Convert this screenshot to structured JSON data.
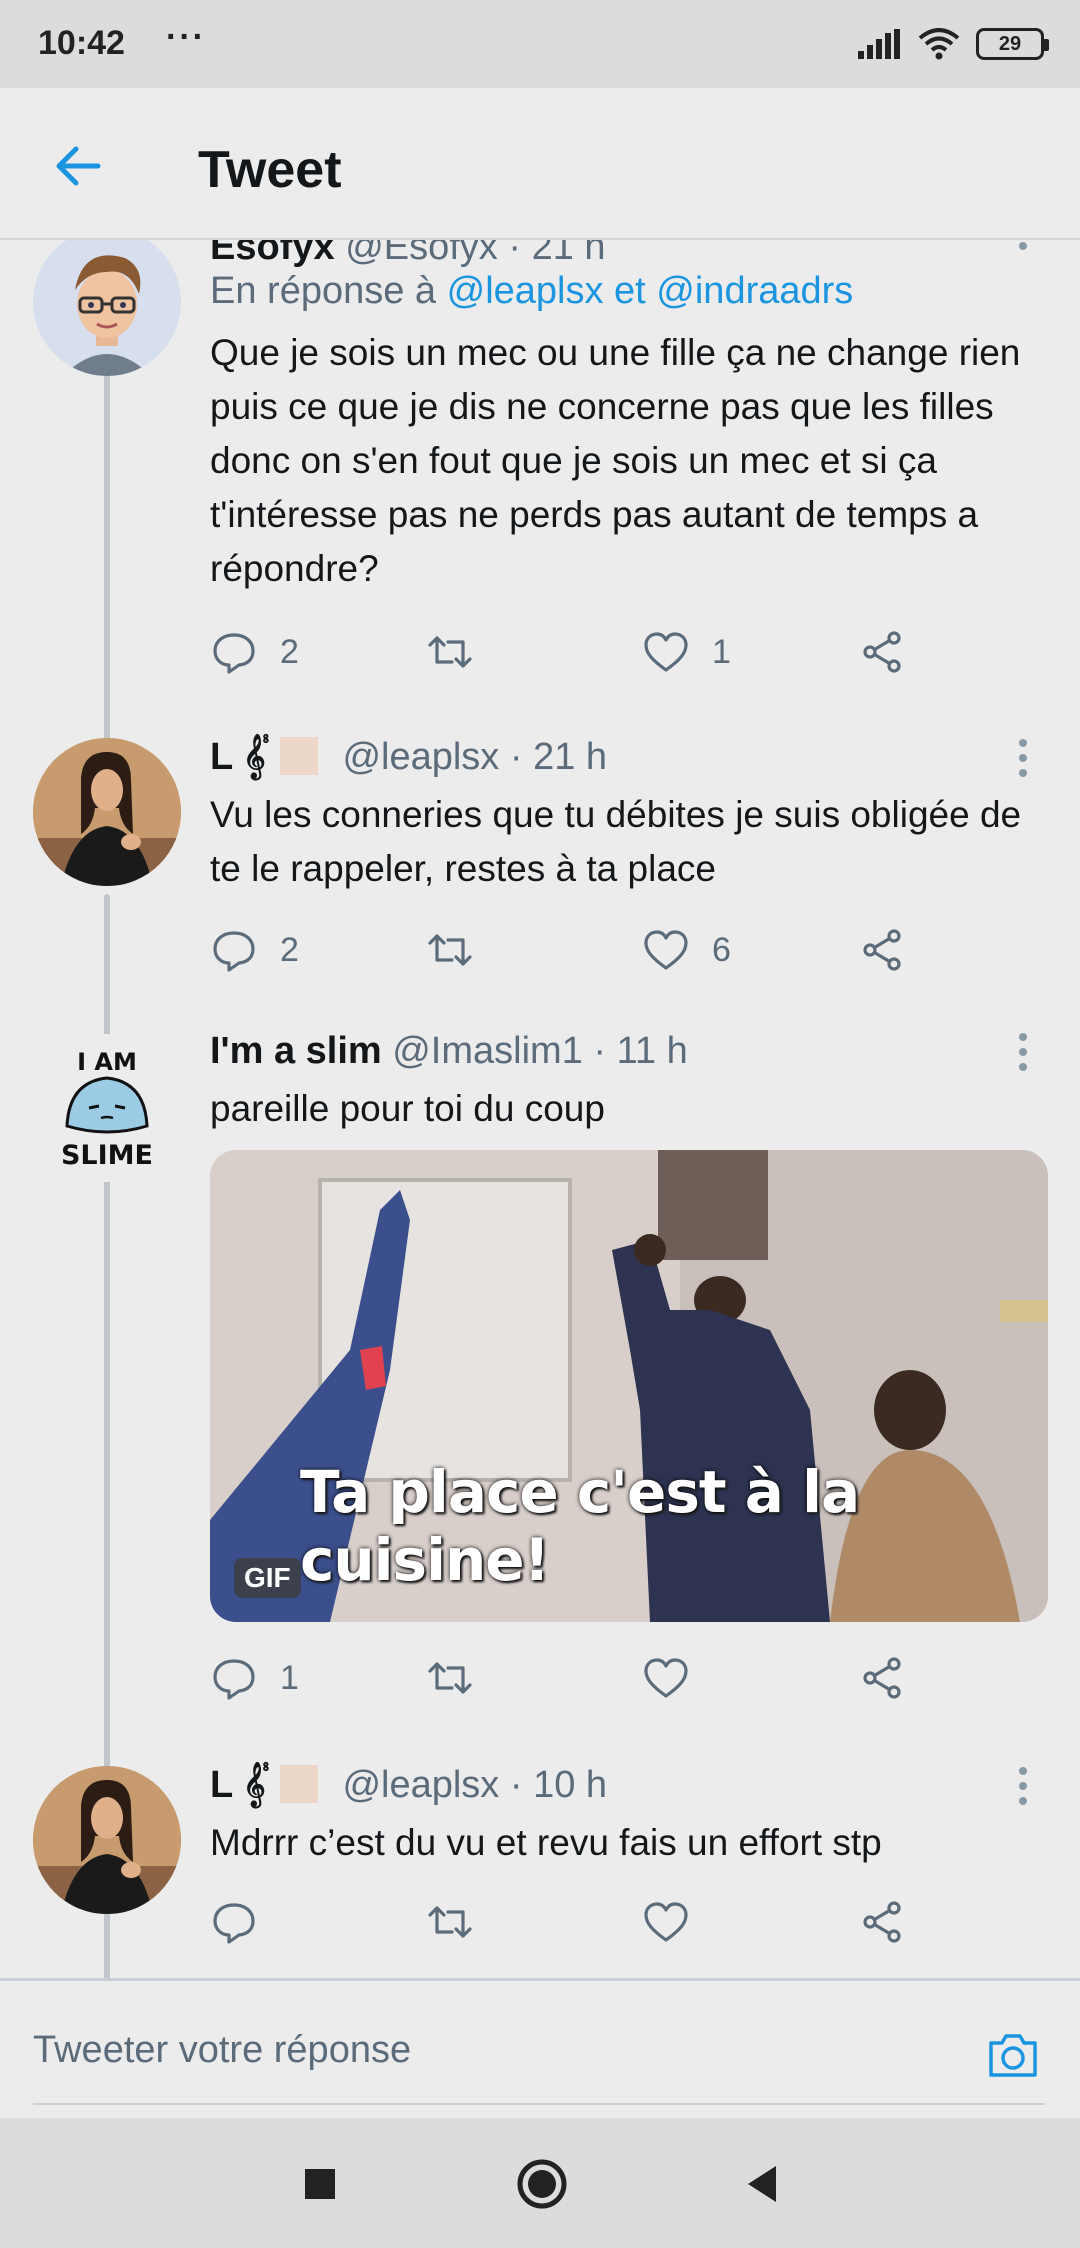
{
  "status_bar": {
    "time": "10:42",
    "dots": "···",
    "battery": "29"
  },
  "header": {
    "title": "Tweet"
  },
  "tweets": [
    {
      "display_name": "Esofyx",
      "handle_time": "@Esofyx · 21 h",
      "reply_prefix": "En réponse à",
      "reply_to": "@leaplsx et @indraadrs",
      "text": "Que je sois un mec ou une fille ça ne change rien puis ce que je dis ne concerne pas que les filles donc on s'en fout que je sois un mec et si ça t'intéresse pas ne perds pas autant de temps a répondre?",
      "replies": "2",
      "retweets": "",
      "likes": "1"
    },
    {
      "display_name": "L 𝄟 ",
      "handle_time": "@leaplsx · 21 h",
      "text": "Vu les conneries que tu débites je suis obligée de te le rappeler, restes à ta place",
      "replies": "2",
      "retweets": "",
      "likes": "6"
    },
    {
      "display_name": "I'm a slim",
      "handle_time": "@Imaslim1 · 11 h",
      "text": "pareille pour toi du coup",
      "gif_caption": "Ta place c'est à la cuisine!",
      "gif_badge": "GIF",
      "replies": "1",
      "retweets": "",
      "likes": ""
    },
    {
      "display_name": "L 𝄟 ",
      "handle_time": "@leaplsx · 10 h",
      "text": "Mdrrr c’est du vu et revu fais un effort stp",
      "replies": "",
      "retweets": "",
      "likes": ""
    }
  ],
  "slime_avatar": {
    "top": "I AM",
    "bottom": "SLIME"
  },
  "compose": {
    "placeholder": "Tweeter votre réponse"
  },
  "colors": {
    "accent": "#1b95e0",
    "secondary_text": "#5b6b7a",
    "background": "#ececec"
  }
}
